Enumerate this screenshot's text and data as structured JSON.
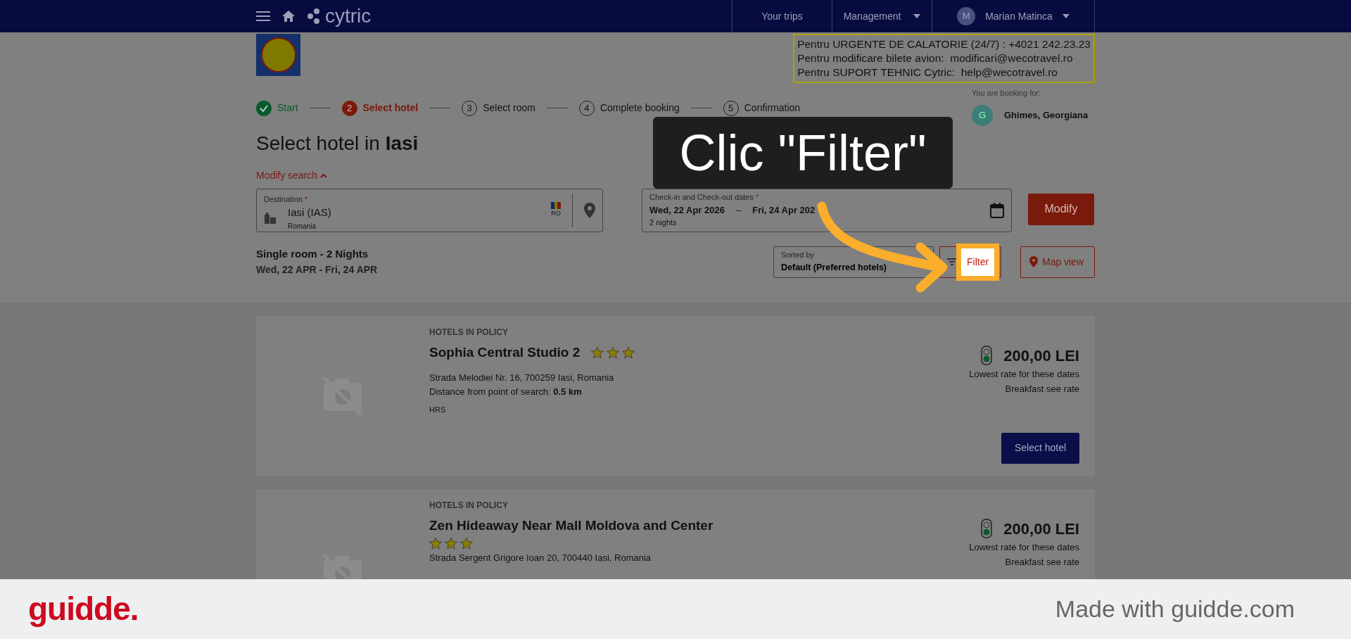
{
  "navbar": {
    "logo": "cytric",
    "links": [
      {
        "label": "Your trips",
        "dropdown": false
      },
      {
        "label": "Management",
        "dropdown": true
      }
    ],
    "user": {
      "initial": "M",
      "name": "Marian Matinca",
      "dropdown": true
    }
  },
  "contact_box": {
    "lines": [
      "Pentru URGENTE DE CALATORIE (24/7) : +4021 242.23.23",
      "Pentru modificare bilete avion:  modificari@wecotravel.ro",
      "Pentru SUPORT TEHNIC Cytric:  help@wecotravel.ro"
    ]
  },
  "steps": [
    {
      "label": "Start",
      "completed": true,
      "selected": false
    },
    {
      "number": "2",
      "label": "Select hotel",
      "completed": false,
      "selected": true
    },
    {
      "number": "3",
      "label": "Select room",
      "completed": false,
      "selected": false
    },
    {
      "number": "4",
      "label": "Complete booking",
      "completed": false,
      "selected": false
    },
    {
      "number": "5",
      "label": "Confirmation",
      "completed": false,
      "selected": false
    }
  ],
  "booking_for": {
    "label": "You are booking for:",
    "initial": "G",
    "name": "Ghimes, Georgiana"
  },
  "title": "Select hotel in **Iasi**",
  "modify_search": {
    "label": "Modify search",
    "expanded": true
  },
  "destination": {
    "label": "Destination",
    "required_mark": "*",
    "value": "Iasi (IAS)",
    "country": "Romania",
    "country_code": "RO"
  },
  "dates": {
    "label": "Check-in and Check-out dates",
    "required_mark": "*",
    "checkin": "Wed, 22 Apr 2026",
    "separator": "–",
    "checkout": "Fri, 24 Apr 202",
    "nights": "2 nights"
  },
  "modify_button": "Modify",
  "summary": {
    "room": "Single room - 2 Nights",
    "dates": "Wed, 22 APR - Fri, 24 APR"
  },
  "sort": {
    "label": "Sorted by",
    "value": "Default (Preferred hotels)"
  },
  "filter_button": "Filter",
  "map_button": "Map view",
  "hotels": [
    {
      "section": "HOTELS IN POLICY",
      "name": "Sophia Central Studio 2",
      "stars": 3,
      "stars_inline": true,
      "address": "Strada Melodiei Nr. 16, 700259 Iasi, Romania",
      "distance_label": "Distance from point of search:",
      "distance": "0.5 km",
      "source": "HRS",
      "price": "200,00 LEI",
      "rate_note": "Lowest rate for these dates",
      "breakfast": "Breakfast see rate",
      "button": "Select hotel"
    },
    {
      "section": "HOTELS IN POLICY",
      "name": "Zen Hideaway Near Mall Moldova and Center",
      "stars": 3,
      "stars_inline": false,
      "address": "Strada Sergent Grigore Ioan 20, 700440 Iasi, Romania",
      "price": "200,00 LEI",
      "rate_note": "Lowest rate for these dates",
      "breakfast": "Breakfast see rate"
    }
  ],
  "callout": {
    "text": "Clic \"Filter\""
  },
  "footer": {
    "logo": "guidde.",
    "text": "Made with guidde.com"
  }
}
